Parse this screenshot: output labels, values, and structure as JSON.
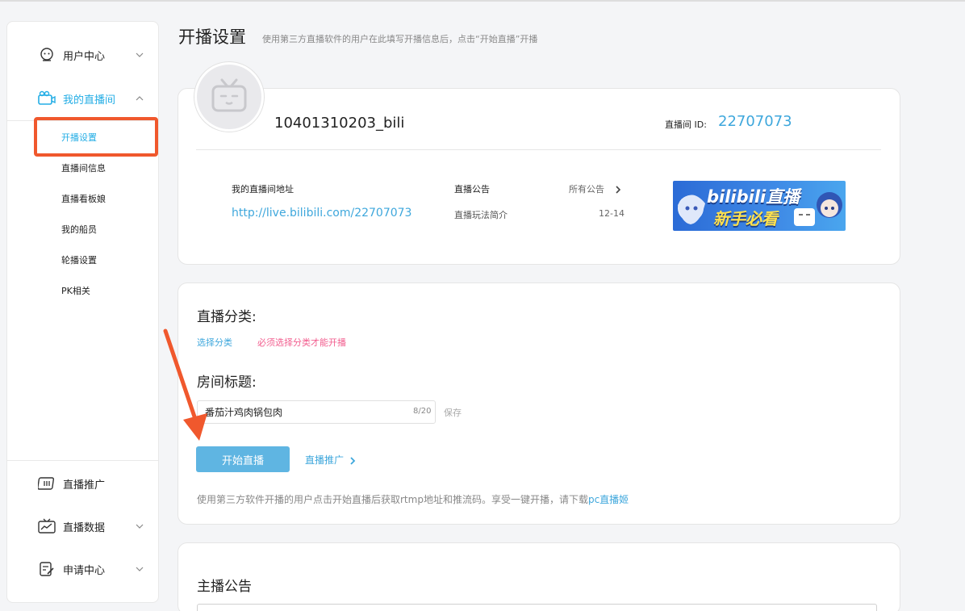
{
  "sidebar": {
    "user_center": "用户中心",
    "my_live_room": "我的直播间",
    "sub_items": [
      "开播设置",
      "直播间信息",
      "直播看板娘",
      "我的船员",
      "轮播设置",
      "PK相关"
    ],
    "live_promotion": "直播推广",
    "live_data": "直播数据",
    "apply_center": "申请中心"
  },
  "header": {
    "title": "开播设置",
    "subtitle": "使用第三方直播软件的用户在此填写开播信息后，点击“开始直播”开播"
  },
  "profile": {
    "username": "10401310203_bili",
    "room_id_label": "直播间 ID:",
    "room_id": "22707073",
    "address_label": "我的直播间地址",
    "address": "http://live.bilibili.com/22707073",
    "notice_label": "直播公告",
    "all_notices": "所有公告",
    "notice_title": "直播玩法简介",
    "notice_date": "12-14",
    "banner_line1": "bilibili直播",
    "banner_line2": "新手必看"
  },
  "settings": {
    "category_heading": "直播分类:",
    "choose_category": "选择分类",
    "category_warning": "必须选择分类才能开播",
    "room_title_heading": "房间标题:",
    "room_title_value": "番茄汁鸡肉锅包肉",
    "title_count": "8/20",
    "save_label": "保存",
    "start_button": "开始直播",
    "promotion_link": "直播推广",
    "footnote_text": "使用第三方软件开播的用户点击开始直播后获取rtmp地址和推流码。享受一键开播，请下载",
    "footnote_link": "pc直播姬"
  },
  "announcement": {
    "heading": "主播公告"
  },
  "colors": {
    "accent": "#23ade5",
    "link": "#3ea7dc",
    "warning": "#f25d8e",
    "start_button": "#5fb5e2",
    "annotation": "#f0582d"
  }
}
